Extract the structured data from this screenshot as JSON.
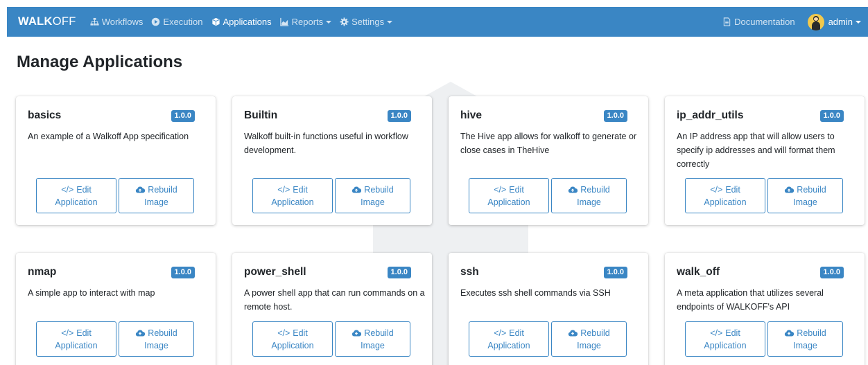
{
  "navbar": {
    "brand_bold": "WALK",
    "brand_rest": "OFF",
    "links": [
      {
        "label": "Workflows",
        "icon": "sitemap-icon"
      },
      {
        "label": "Execution",
        "icon": "play-circle-icon"
      },
      {
        "label": "Applications",
        "icon": "cube-icon",
        "active": true
      },
      {
        "label": "Reports",
        "icon": "area-chart-icon",
        "dropdown": true
      },
      {
        "label": "Settings",
        "icon": "gear-icon",
        "dropdown": true
      }
    ],
    "documentation_label": "Documentation",
    "user_label": "admin"
  },
  "page": {
    "title": "Manage Applications"
  },
  "apps": [
    {
      "name": "basics",
      "version": "1.0.0",
      "description": "An example of a Walkoff App specification"
    },
    {
      "name": "Builtin",
      "version": "1.0.0",
      "description": "Walkoff built-in functions useful in workflow development."
    },
    {
      "name": "hive",
      "version": "1.0.0",
      "description": "The Hive app allows for walkoff to generate or close cases in TheHive"
    },
    {
      "name": "ip_addr_utils",
      "version": "1.0.0",
      "description": "An IP address app that will allow users to specify ip addresses and will format them correctly"
    },
    {
      "name": "nmap",
      "version": "1.0.0",
      "description": "A simple app to interact with map"
    },
    {
      "name": "power_shell",
      "version": "1.0.0",
      "description": "A power shell app that can run commands on a remote host."
    },
    {
      "name": "ssh",
      "version": "1.0.0",
      "description": "Executes ssh shell commands via SSH"
    },
    {
      "name": "walk_off",
      "version": "1.0.0",
      "description": "A meta application that utilizes several endpoints of WALKOFF's API"
    }
  ],
  "buttons": {
    "edit_line1": "Edit",
    "edit_line2": "Application",
    "rebuild_line1": "Rebuild",
    "rebuild_line2": "Image"
  },
  "colors": {
    "primary": "#3a86c4",
    "watermark": "#e9ecef"
  }
}
